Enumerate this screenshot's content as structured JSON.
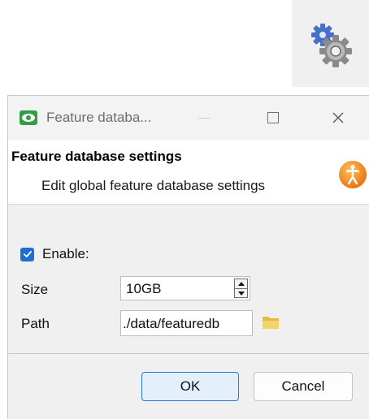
{
  "gear_tile": {
    "icon": "gears-icon"
  },
  "dialog": {
    "window_title": "Feature databa...",
    "icon": "eye-app-icon",
    "header": {
      "title": "Feature database settings",
      "subtitle": "Edit global feature database settings",
      "icon": "person-accessibility-icon"
    },
    "enable": {
      "label": "Enable:",
      "checked": true
    },
    "size": {
      "label": "Size",
      "value": "10GB"
    },
    "path": {
      "label": "Path",
      "value": "./data/featuredb"
    },
    "buttons": {
      "ok": "OK",
      "cancel": "Cancel"
    },
    "colors": {
      "accent": "#1f6fd1",
      "header_icon": "#f08a1c",
      "folder": "#f0c040"
    }
  }
}
